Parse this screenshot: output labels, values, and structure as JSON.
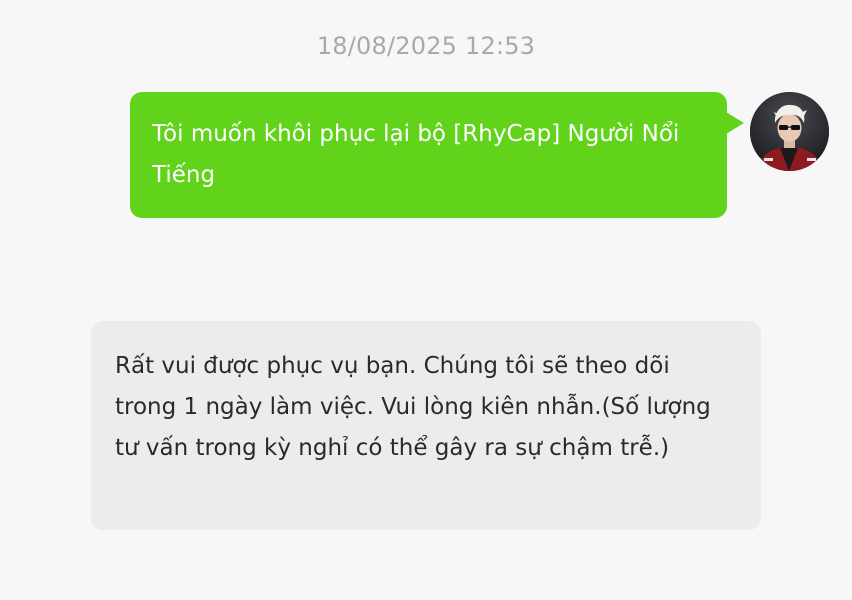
{
  "conversation": {
    "timestamp": "18/08/2025 12:53",
    "messages": [
      {
        "sender": "user",
        "text": "Tôi muốn khôi phục lại bộ [RhyCap] Người Nổi Tiếng",
        "avatar_icon": "user-avatar-icon"
      },
      {
        "sender": "support",
        "text": "Rất vui được phục vụ bạn. Chúng tôi sẽ theo dõi trong 1 ngày làm việc. Vui lòng kiên nhẫn.(Số lượng tư vấn trong kỳ nghỉ có thể gây ra sự chậm trễ.)"
      }
    ]
  },
  "colors": {
    "background": "#f7f7f7",
    "outgoing_bubble": "#62d31b",
    "incoming_bubble": "#ececec",
    "timestamp_text": "#a9a9a9"
  }
}
